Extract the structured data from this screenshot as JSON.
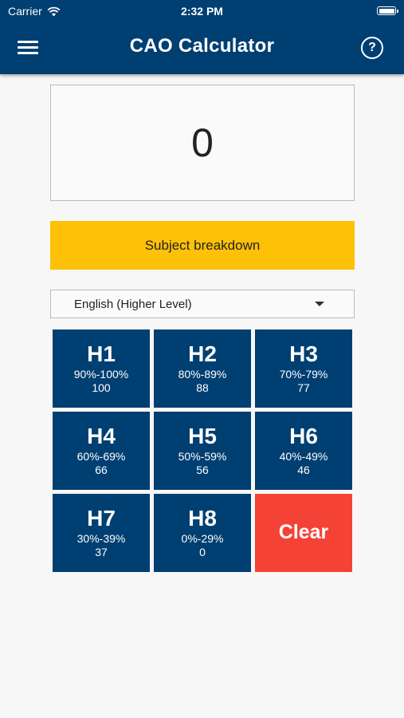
{
  "status_bar": {
    "carrier": "Carrier",
    "time": "2:32 PM"
  },
  "app_bar": {
    "title": "CAO Calculator"
  },
  "score": {
    "value": "0"
  },
  "breakdown_button": {
    "label": "Subject breakdown"
  },
  "subject_select": {
    "selected": "English (Higher Level)"
  },
  "grades": [
    {
      "grade": "H1",
      "range": "90%-100%",
      "points": "100"
    },
    {
      "grade": "H2",
      "range": "80%-89%",
      "points": "88"
    },
    {
      "grade": "H3",
      "range": "70%-79%",
      "points": "77"
    },
    {
      "grade": "H4",
      "range": "60%-69%",
      "points": "66"
    },
    {
      "grade": "H5",
      "range": "50%-59%",
      "points": "56"
    },
    {
      "grade": "H6",
      "range": "40%-49%",
      "points": "46"
    },
    {
      "grade": "H7",
      "range": "30%-39%",
      "points": "37"
    },
    {
      "grade": "H8",
      "range": "0%-29%",
      "points": "0"
    }
  ],
  "clear_button": {
    "label": "Clear"
  },
  "icons": {
    "menu": "hamburger-menu-icon",
    "help": "help-circle-icon",
    "dropdown": "dropdown-caret-icon",
    "wifi": "wifi-icon",
    "battery": "battery-icon"
  },
  "colors": {
    "primary": "#003f72",
    "accent": "#fec107",
    "clear": "#f44336",
    "background": "#f7f7f7"
  }
}
